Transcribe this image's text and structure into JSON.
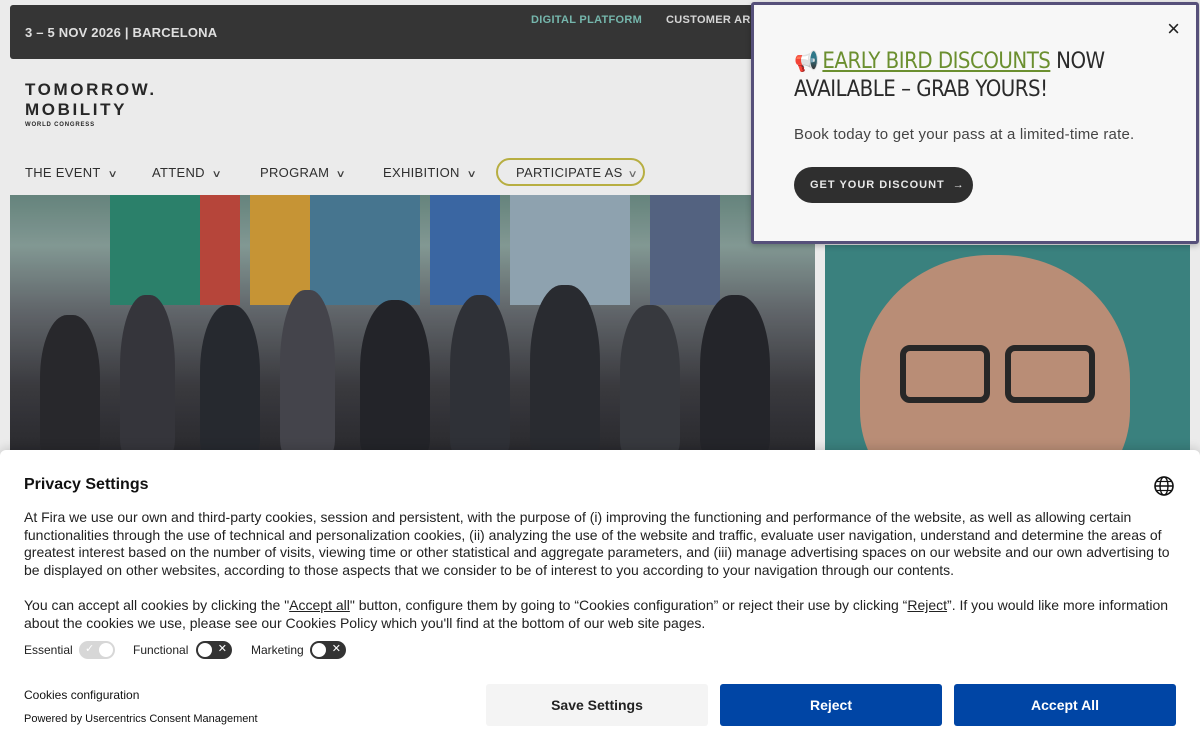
{
  "topbar": {
    "date_location": "3 – 5 NOV 2026 | BARCELONA",
    "digital_platform": "DIGITAL PLATFORM",
    "customer_area": "CUSTOMER AR"
  },
  "logo": {
    "line1": "TOMORROW.",
    "line2": "MOBILITY",
    "line3": "WORLD CONGRESS"
  },
  "nav": {
    "items": [
      "THE EVENT",
      "ATTEND",
      "PROGRAM",
      "EXHIBITION"
    ],
    "participate": "PARTICIPATE AS"
  },
  "promo": {
    "close": "×",
    "icon": "megaphone-icon",
    "megaphone_glyph": "📢",
    "link_text": "EARLY BIRD DISCOUNTS",
    "headline_rest": " NOW AVAILABLE – GRAB YOURS!",
    "subtext": "Book today to get your pass at a limited-time rate.",
    "cta_label": "GET YOUR DISCOUNT",
    "cta_arrow": "→",
    "accent_color": "#6b8f2f",
    "border_color": "#56507a"
  },
  "cookie": {
    "title": "Privacy Settings",
    "paragraph1": "At Fira we use our own and third-party cookies, session and persistent, with the purpose of (i) improving the functioning and performance of the website, as well as allowing certain functionalities through the use of technical and personalization cookies, (ii) analyzing the use of the website and traffic, evaluate user navigation, understand and determine the areas of greatest interest based on the number of visits, viewing time or other statistical and aggregate parameters, and (iii) manage advertising spaces on our website and our own advertising to be displayed on other websites, according to those aspects that we consider to be of interest to you according to your navigation through our contents.",
    "p2_a": "You can accept all cookies by clicking the \"",
    "p2_accept": "Accept all",
    "p2_b": "\" button, configure them by going to “Cookies configuration” or reject their use by clicking “",
    "p2_reject": "Reject",
    "p2_c": "”. If you would like more information about the cookies we use, please see our Cookies Policy which you'll find at the bottom of our web site pages.",
    "toggles": {
      "essential": {
        "label": "Essential",
        "on": true
      },
      "functional": {
        "label": "Functional",
        "on": false
      },
      "marketing": {
        "label": "Marketing",
        "on": false
      }
    },
    "cookies_configuration": "Cookies configuration",
    "powered_by": "Powered by Usercentrics Consent Management",
    "buttons": {
      "save": "Save Settings",
      "reject": "Reject",
      "accept": "Accept All"
    },
    "primary_color": "#0045a5"
  }
}
